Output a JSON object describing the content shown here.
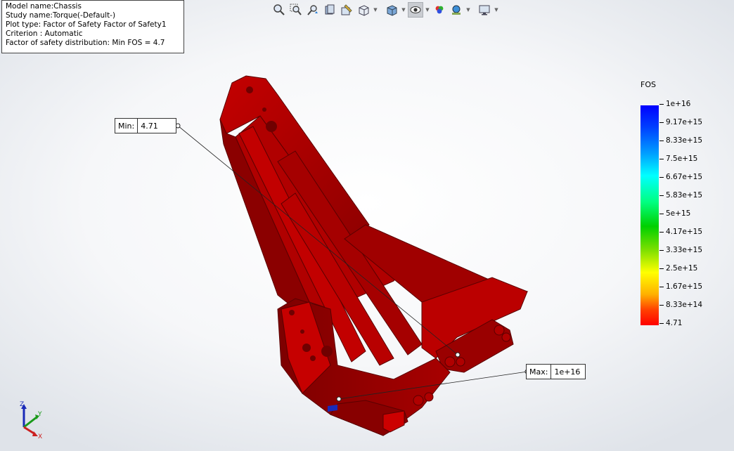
{
  "info": {
    "model_name": "Model name:Chassis",
    "study_name": "Study name:Torque(-Default-)",
    "plot_type": "Plot type: Factor of Safety Factor of Safety1",
    "criterion": "Criterion : Automatic",
    "distribution": "Factor of safety distribution: Min FOS = 4.7"
  },
  "toolbar": {
    "icons": [
      "zoom-to-fit-icon",
      "zoom-to-area-icon",
      "previous-view-icon",
      "section-view-icon",
      "dynamic-annotation-icon",
      "view-orientation-icon",
      "display-style-icon",
      "hide-show-items-icon",
      "edit-appearance-icon",
      "apply-scene-icon",
      "view-settings-icon"
    ]
  },
  "callouts": {
    "min": {
      "label": "Min:",
      "value": "4.71"
    },
    "max": {
      "label": "Max:",
      "value": "1e+16"
    }
  },
  "legend": {
    "title": "FOS",
    "labels": [
      "1e+16",
      "9.17e+15",
      "8.33e+15",
      "7.5e+15",
      "6.67e+15",
      "5.83e+15",
      "5e+15",
      "4.17e+15",
      "3.33e+15",
      "2.5e+15",
      "1.67e+15",
      "8.33e+14",
      "4.71"
    ]
  },
  "triad": {
    "x": "X",
    "y": "Y",
    "z": "Z"
  },
  "colors": {
    "part_red": "#b50000",
    "part_dark": "#7a0000"
  }
}
